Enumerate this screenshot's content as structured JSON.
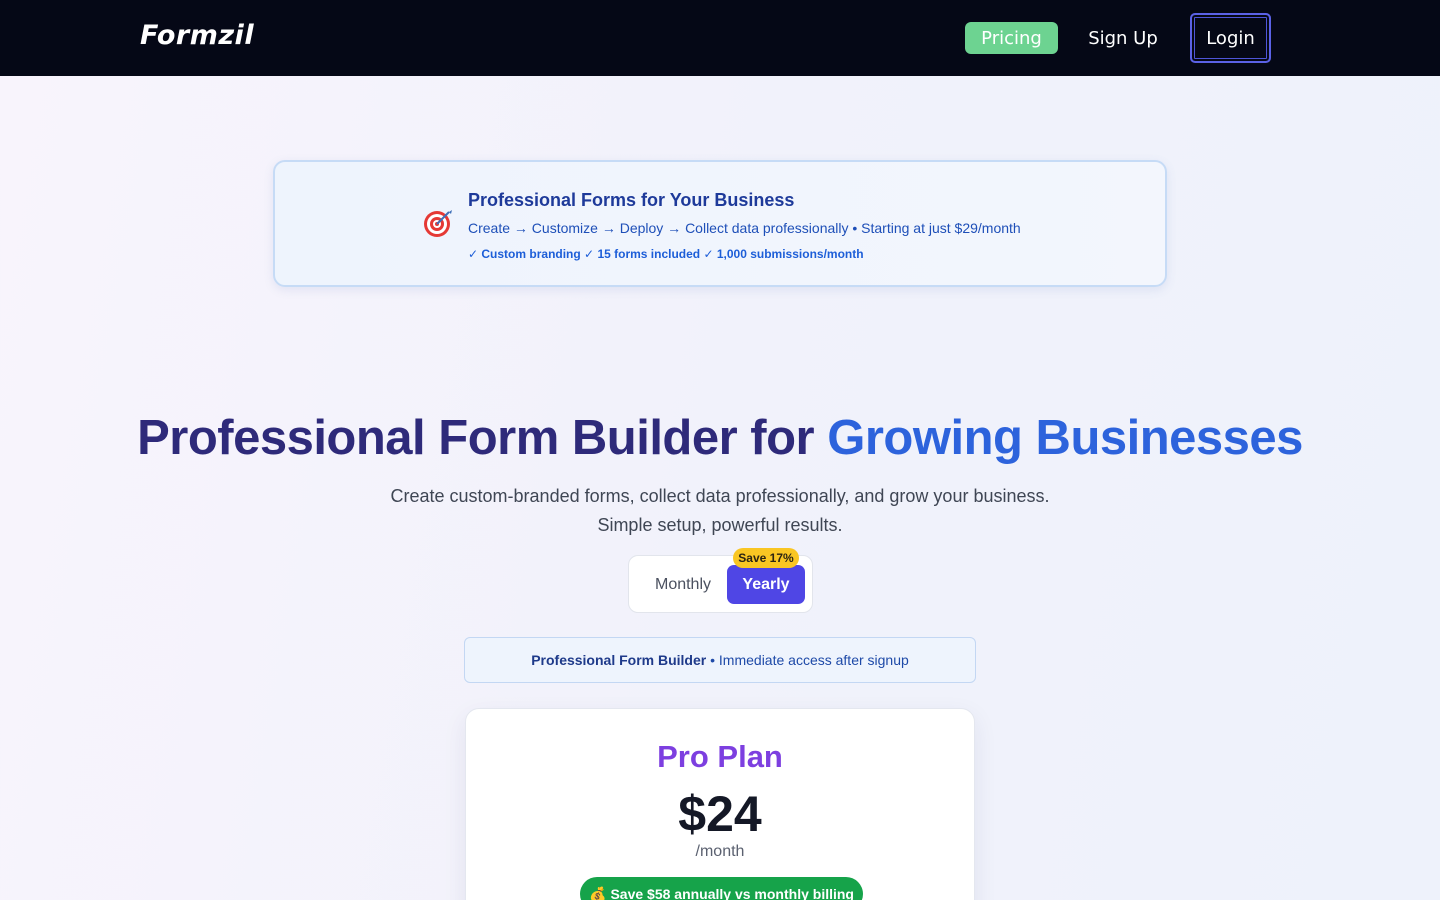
{
  "nav": {
    "logo": "Formzil",
    "pricing_label": "Pricing",
    "signup_label": "Sign Up",
    "login_label": "Login"
  },
  "banner": {
    "icon": "target-icon",
    "title": "Professional Forms for Your Business",
    "subtitle": "Create → Customize → Deploy → Collect data professionally • Starting at just $29/month",
    "features": "✓ Custom branding ✓ 15 forms included ✓ 1,000 submissions/month"
  },
  "hero": {
    "title_main": "Professional Form Builder for ",
    "title_accent": "Growing Businesses",
    "subtitle_line1": "Create custom-branded forms, collect data professionally, and grow your business.",
    "subtitle_line2": "Simple setup, powerful results."
  },
  "billing_toggle": {
    "monthly_label": "Monthly",
    "yearly_label": "Yearly",
    "save_badge": "Save 17%",
    "selected": "Yearly"
  },
  "info_box": {
    "strong": "Professional Form Builder",
    "text": " • Immediate access after signup"
  },
  "plan": {
    "name": "Pro Plan",
    "price": "$24",
    "period": "/month",
    "save_icon": "money-bag-icon",
    "save_text": "Save $58 annually vs monthly billing"
  },
  "colors": {
    "nav_bg": "#050816",
    "pricing_green": "#6dd391",
    "accent_blue": "#2d63dc",
    "toggle_active": "#4f46e5",
    "badge_yellow": "#f9c623",
    "plan_purple": "#7d3fe0",
    "save_green": "#16a34a"
  }
}
